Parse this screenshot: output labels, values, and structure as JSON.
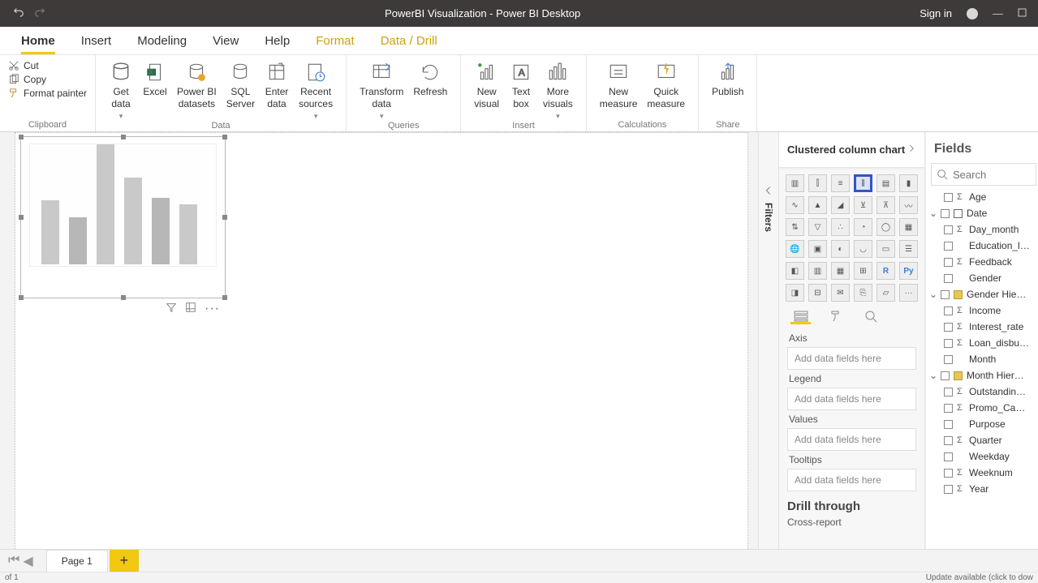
{
  "titlebar": {
    "title": "PowerBI Visualization - Power BI Desktop",
    "signin": "Sign in"
  },
  "tabs": {
    "home": "Home",
    "insert": "Insert",
    "modeling": "Modeling",
    "view": "View",
    "help": "Help",
    "format": "Format",
    "datadrill": "Data / Drill"
  },
  "ribbon": {
    "clipboard": {
      "cut": "Cut",
      "copy": "Copy",
      "painter": "Format painter",
      "label": "Clipboard"
    },
    "data": {
      "getdata": "Get\ndata",
      "excel": "Excel",
      "pbidata": "Power BI\ndatasets",
      "sql": "SQL\nServer",
      "enter": "Enter\ndata",
      "recent": "Recent\nsources",
      "label": "Data"
    },
    "queries": {
      "transform": "Transform\ndata",
      "refresh": "Refresh",
      "label": "Queries"
    },
    "insert": {
      "newvisual": "New\nvisual",
      "textbox": "Text\nbox",
      "morevisuals": "More\nvisuals",
      "label": "Insert"
    },
    "calc": {
      "newmeasure": "New\nmeasure",
      "quickmeasure": "Quick\nmeasure",
      "label": "Calculations"
    },
    "share": {
      "publish": "Publish",
      "label": "Share"
    }
  },
  "filters": {
    "label": "Filters"
  },
  "viz": {
    "header": "Clustered column chart",
    "wells": {
      "axis": "Axis",
      "legend": "Legend",
      "values": "Values",
      "tooltips": "Tooltips",
      "placeholder": "Add data fields here"
    },
    "drill": "Drill through",
    "cross": "Cross-report"
  },
  "fields": {
    "title": "Fields",
    "search": "Search",
    "items": [
      {
        "name": "Age",
        "sigma": true
      },
      {
        "name": "Date",
        "cal": true,
        "group": true
      },
      {
        "name": "Day_month",
        "sigma": true
      },
      {
        "name": "Education_l…"
      },
      {
        "name": "Feedback",
        "sigma": true
      },
      {
        "name": "Gender"
      },
      {
        "name": "Gender Hie…",
        "hier": true,
        "group": true
      },
      {
        "name": "Income",
        "sigma": true
      },
      {
        "name": "Interest_rate",
        "sigma": true
      },
      {
        "name": "Loan_disbu…",
        "sigma": true
      },
      {
        "name": "Month"
      },
      {
        "name": "Month Hier…",
        "hier": true,
        "group": true
      },
      {
        "name": "Outstandin…",
        "sigma": true
      },
      {
        "name": "Promo_Ca…",
        "sigma": true
      },
      {
        "name": "Purpose"
      },
      {
        "name": "Quarter",
        "sigma": true
      },
      {
        "name": "Weekday"
      },
      {
        "name": "Weeknum",
        "sigma": true
      },
      {
        "name": "Year",
        "sigma": true
      }
    ]
  },
  "pages": {
    "page1": "Page 1"
  },
  "status": {
    "left": "of 1",
    "right": "Update available (click to dow"
  },
  "chart_data": {
    "type": "bar",
    "note": "placeholder sample bars shown in empty visual (no real data bound)",
    "values": [
      48,
      35,
      90,
      65,
      50,
      45
    ],
    "colors": [
      "light",
      "dark",
      "light",
      "light",
      "dark",
      "light"
    ]
  }
}
